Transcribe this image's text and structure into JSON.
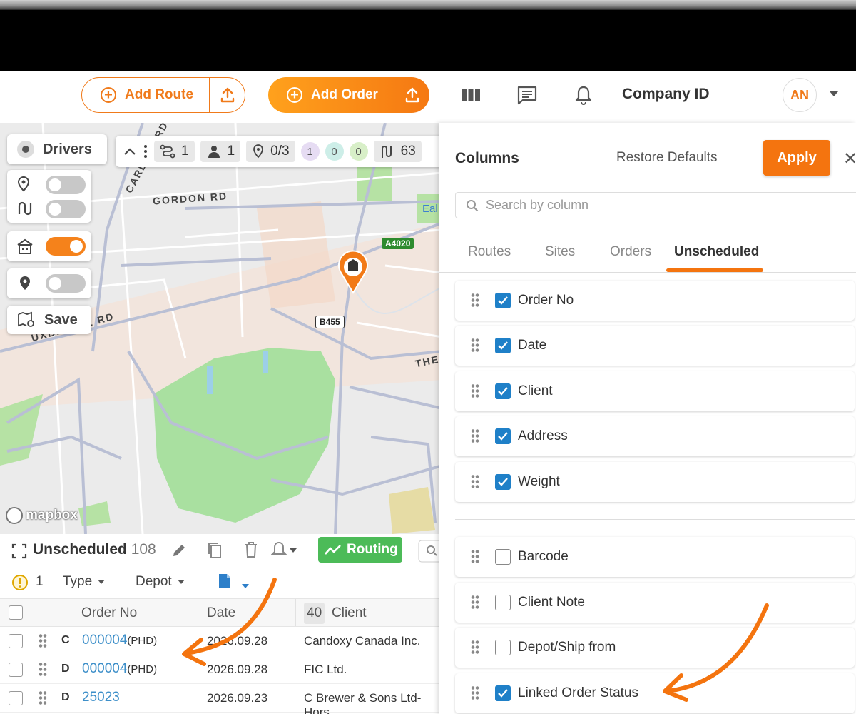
{
  "header": {
    "add_route_label": "Add Route",
    "add_order_label": "Add Order",
    "company_label": "Company ID",
    "avatar_initials": "AN",
    "accent_color": "#f07a1a"
  },
  "map": {
    "drivers_label": "Drivers",
    "save_label": "Save",
    "stats": {
      "routes": "1",
      "drivers": "1",
      "stops": "0/3",
      "badge_a": "1",
      "badge_b": "0",
      "badge_c": "0",
      "lengths": "63"
    },
    "labels": {
      "gordon_rd": "GORDON RD",
      "uxbridge_rd": "UXBRIDGE RD",
      "carlton_rd": "CARLTON RD",
      "the": "THE",
      "ealing": "Eal",
      "a4020": "A4020",
      "b455": "B455"
    },
    "attribution": "mapbox"
  },
  "unscheduled": {
    "title": "Unscheduled",
    "count": "108",
    "routing_label": "Routing",
    "filters": {
      "warning_count": "1",
      "type_label": "Type",
      "depot_label": "Depot"
    },
    "columns": {
      "order_no": "Order No",
      "date": "Date",
      "client_count": "40",
      "client": "Client"
    },
    "rows": [
      {
        "type": "C",
        "order_no": "000004",
        "suffix": "(PHD)",
        "date": "2026.09.28",
        "client": "Candoxy Canada Inc."
      },
      {
        "type": "D",
        "order_no": "000004",
        "suffix": "(PHD)",
        "date": "2026.09.28",
        "client": "FIC Ltd."
      },
      {
        "type": "D",
        "order_no": "25023",
        "suffix": "",
        "date": "2026.09.23",
        "client": "C Brewer & Sons Ltd-Hors"
      }
    ]
  },
  "columns_panel": {
    "title": "Columns",
    "restore_label": "Restore Defaults",
    "apply_label": "Apply",
    "search_placeholder": "Search by column",
    "tabs": [
      "Routes",
      "Sites",
      "Orders",
      "Unscheduled"
    ],
    "active_tab": "Unscheduled",
    "checked": [
      "Order No",
      "Date",
      "Client",
      "Address",
      "Weight"
    ],
    "unchecked": [
      "Barcode",
      "Client Note",
      "Depot/Ship from"
    ],
    "linked": "Linked Order Status"
  }
}
